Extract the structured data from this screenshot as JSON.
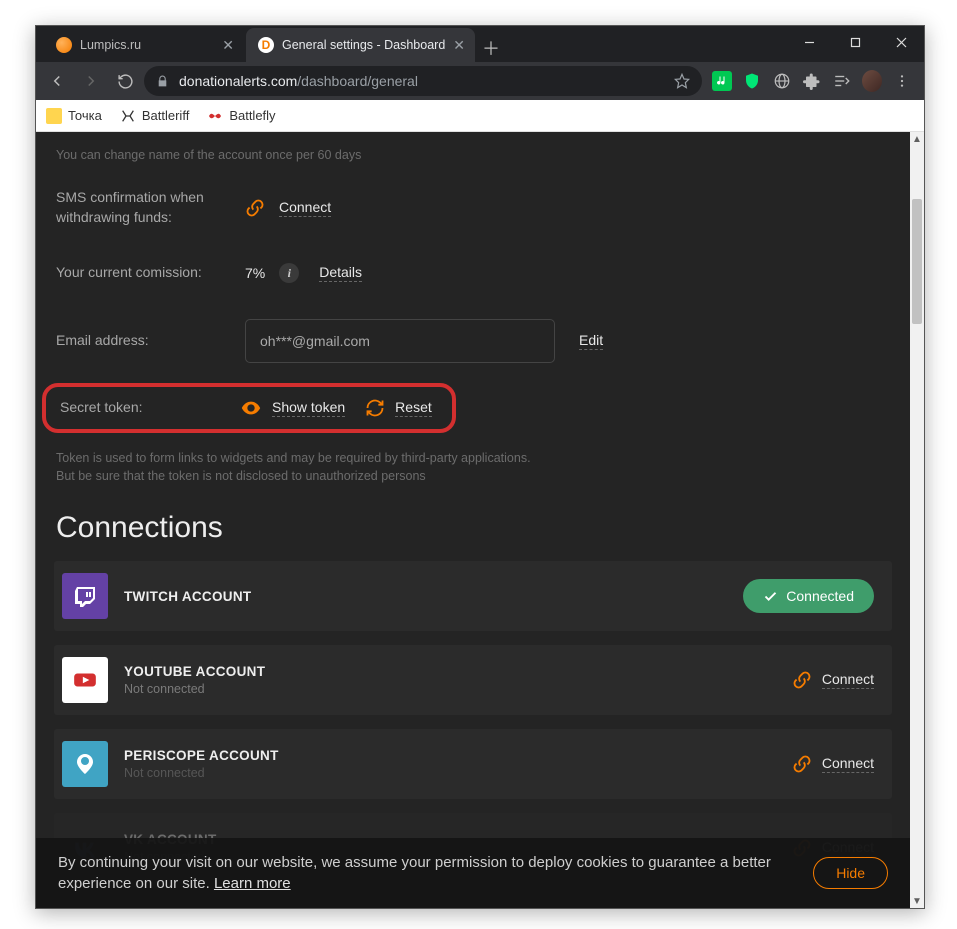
{
  "window": {
    "tabs": [
      {
        "title": "Lumpics.ru",
        "active": false
      },
      {
        "title": "General settings - Dashboard",
        "active": true
      }
    ]
  },
  "toolbar": {
    "url_host": "donationalerts.com",
    "url_path": "/dashboard/general"
  },
  "bookmarks": [
    {
      "label": "Точка"
    },
    {
      "label": "Battleriff"
    },
    {
      "label": "Battlefly"
    }
  ],
  "settings": {
    "name_hint": "You can change name of the account once per 60 days",
    "sms_label": "SMS confirmation when withdrawing funds:",
    "sms_connect": "Connect",
    "commission_label": "Your current comission:",
    "commission_value": "7%",
    "commission_details": "Details",
    "email_label": "Email address:",
    "email_value": "oh***@gmail.com",
    "email_edit": "Edit",
    "token_label": "Secret token:",
    "token_show": "Show token",
    "token_reset": "Reset",
    "token_hint1": "Token is used to form links to widgets and may be required by third-party applications.",
    "token_hint2": "But be sure that the token is not disclosed to unauthorized persons"
  },
  "connections": {
    "header": "Connections",
    "connected_label": "Connected",
    "connect_label": "Connect",
    "not_connected": "Not connected",
    "items": [
      {
        "title": "TWITCH ACCOUNT",
        "status": "connected"
      },
      {
        "title": "YOUTUBE ACCOUNT",
        "status": "disconnected"
      },
      {
        "title": "PERISCOPE ACCOUNT",
        "status": "disconnected"
      },
      {
        "title": "VK ACCOUNT",
        "status": "disconnected"
      }
    ]
  },
  "cookie": {
    "text": "By continuing your visit on our website, we assume your permission to deploy cookies to guarantee a better experience on our site. ",
    "learn_more": "Learn more",
    "hide": "Hide"
  }
}
